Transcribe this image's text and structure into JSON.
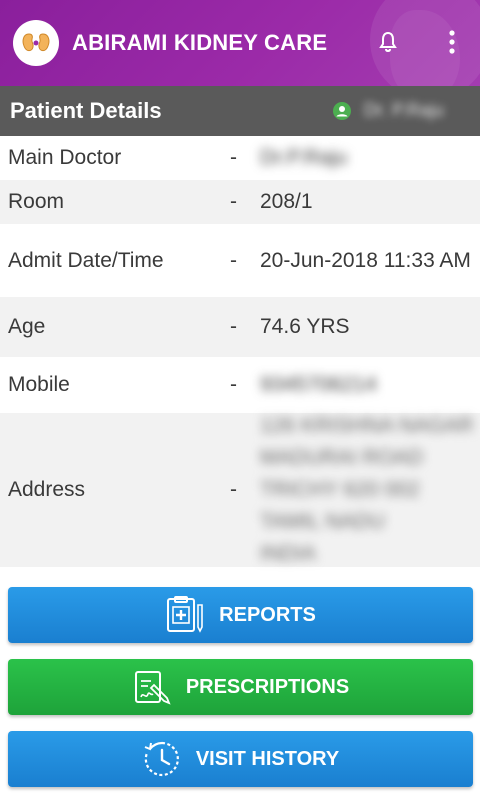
{
  "app": {
    "title": "ABIRAMI KIDNEY CARE",
    "brand_color": "#8a1f9c"
  },
  "section": {
    "title": "Patient Details",
    "user_name": "Dr. P.Raju"
  },
  "details": [
    {
      "label": "Main Doctor",
      "sep": "-",
      "value": "Dr.P.Raju",
      "blurred": true
    },
    {
      "label": "Room",
      "sep": "-",
      "value": "208/1",
      "blurred": false
    },
    {
      "label": "Admit Date/Time",
      "sep": "-",
      "value": "20-Jun-2018 11:33 AM",
      "blurred": false
    },
    {
      "label": "Age",
      "sep": "-",
      "value": "74.6 YRS",
      "blurred": false
    },
    {
      "label": "Mobile",
      "sep": "-",
      "value": "9345706214",
      "blurred": true
    },
    {
      "label": "Address",
      "sep": "-",
      "value_lines": [
        "126 KRISHNA NAGAR",
        "MADURAI ROAD",
        "TRICHY 620 002",
        "TAMIL NADU",
        "INDIA"
      ],
      "blurred": true
    }
  ],
  "buttons": {
    "reports": "REPORTS",
    "prescriptions": "PRESCRIPTIONS",
    "visit_history": "VISIT HISTORY"
  },
  "icons": {
    "logo": "kidney-icon",
    "bell": "bell-icon",
    "menu": "more-vert-icon",
    "user": "user-icon",
    "reports": "clipboard-icon",
    "prescriptions": "prescription-icon",
    "visit_history": "clock-history-icon"
  }
}
